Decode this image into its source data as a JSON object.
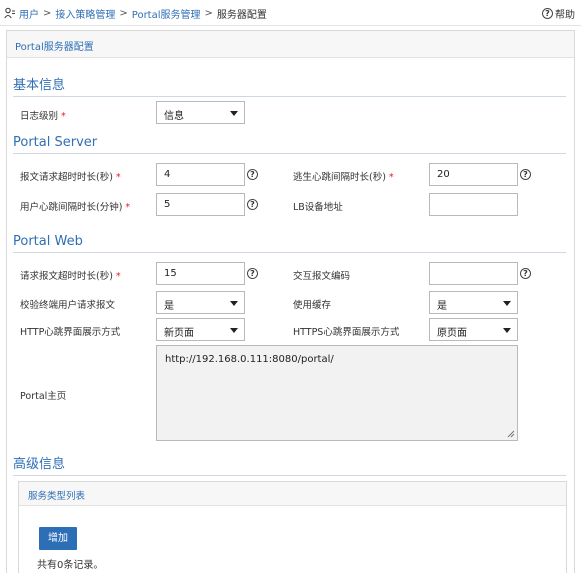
{
  "breadcrumb": {
    "items": [
      "用户",
      "接入策略管理",
      "Portal服务管理",
      "服务器配置"
    ],
    "separator": ">"
  },
  "help": {
    "label": "帮助",
    "icon": "question-circle-icon"
  },
  "panel": {
    "title": "Portal服务器配置"
  },
  "sections": {
    "basic": "基本信息",
    "server": "Portal Server",
    "web": "Portal Web",
    "advanced": "高级信息"
  },
  "fields": {
    "log_level": {
      "label": "日志级别",
      "value": "信息"
    },
    "req_timeout": {
      "label": "报文请求超时时长(秒)",
      "value": "4"
    },
    "heartbeat_escape": {
      "label": "逃生心跳间隔时长(秒)",
      "value": "20"
    },
    "user_heartbeat": {
      "label": "用户心跳间隔时长(分钟)",
      "value": "5"
    },
    "lb_addr": {
      "label": "LB设备地址",
      "value": ""
    },
    "web_req_timeout": {
      "label": "请求报文超时时长(秒)",
      "value": "15"
    },
    "encoding": {
      "label": "交互报文编码",
      "value": ""
    },
    "verify_terminal": {
      "label": "校验终端用户请求报文",
      "value": "是"
    },
    "use_cache": {
      "label": "使用缓存",
      "value": "是"
    },
    "http_heartbeat_mode": {
      "label": "HTTP心跳界面展示方式",
      "value": "新页面"
    },
    "https_heartbeat_mode": {
      "label": "HTTPS心跳界面展示方式",
      "value": "原页面"
    },
    "portal_home": {
      "label": "Portal主页",
      "value": "http://192.168.0.111:8080/portal/"
    }
  },
  "required_mark": "*",
  "help_mark": "?",
  "service_list": {
    "title": "服务类型列表",
    "add_label": "增加",
    "count_text": "共有0条记录。"
  },
  "colors": {
    "link": "#2f6fb5",
    "accent_button": "#2d6fb7",
    "required": "#d9232e"
  }
}
